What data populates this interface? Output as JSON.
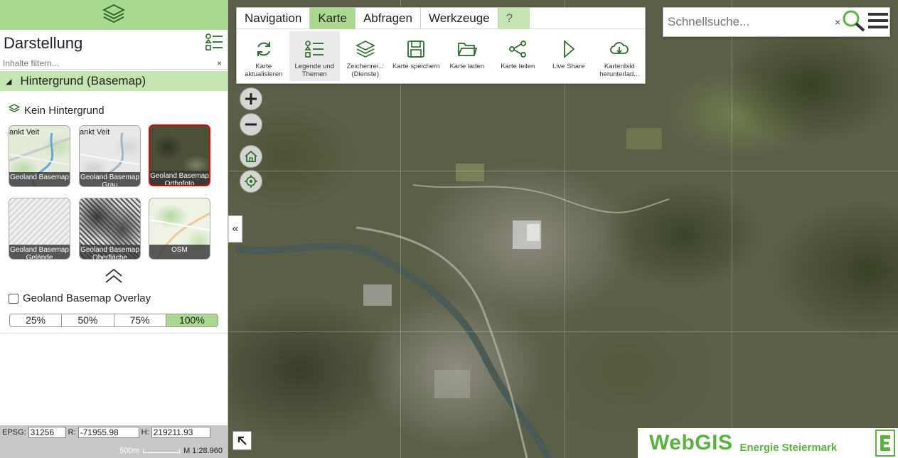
{
  "sidebar": {
    "title": "Darstellung",
    "filter_placeholder": "Inhalte filtern...",
    "filter_clear": "×",
    "section_title": "Hintergrund (Basemap)",
    "no_background_label": "Kein Hintergrund",
    "basemaps": [
      {
        "caption": "Geoland Basemap",
        "top_label": "ankt Veit",
        "selected": false
      },
      {
        "caption": "Geoland Basemap Grau",
        "top_label": "ankt Veit",
        "selected": false
      },
      {
        "caption": "Geoland Basemap Orthofoto",
        "top_label": "",
        "selected": true
      },
      {
        "caption": "Geoland Basemap Gelände",
        "top_label": "",
        "selected": false
      },
      {
        "caption": "Geoland Basemap Oberfläche",
        "top_label": "",
        "selected": false
      },
      {
        "caption": "OSM",
        "top_label": "",
        "selected": false
      }
    ],
    "overlay_label": "Geoland Basemap Overlay",
    "opacity_options": [
      "25%",
      "50%",
      "75%",
      "100%"
    ],
    "opacity_selected": "100%"
  },
  "coords": {
    "epsg_label": "EPSG:",
    "epsg_value": "31256",
    "r_label": "R:",
    "r_value": "-71955.98",
    "h_label": "H:",
    "h_value": "219211.93",
    "scale_bar_label": "500m",
    "scale_label": "M 1:28.960"
  },
  "ribbon": {
    "tabs": [
      {
        "label": "Navigation",
        "active": false
      },
      {
        "label": "Karte",
        "active": true
      },
      {
        "label": "Abfragen",
        "active": false
      },
      {
        "label": "Werkzeuge",
        "active": false
      },
      {
        "label": "?",
        "active": false
      }
    ],
    "tools": [
      {
        "label": "Karte aktualisieren",
        "icon": "refresh-icon"
      },
      {
        "label": "Legende und Themen",
        "icon": "legend-icon"
      },
      {
        "label": "Zeichenrei... (Dienste)",
        "icon": "layers-icon"
      },
      {
        "label": "Karte speichern",
        "icon": "save-icon"
      },
      {
        "label": "Karte laden",
        "icon": "folder-icon"
      },
      {
        "label": "Karte teilen",
        "icon": "share-icon"
      },
      {
        "label": "Live Share",
        "icon": "play-icon"
      },
      {
        "label": "Kartenbild herunterlad...",
        "icon": "cloud-download-icon"
      }
    ]
  },
  "search": {
    "placeholder": "Schnellsuche...",
    "clear": "×"
  },
  "logo": {
    "main": "WebGIS",
    "sub": "Energie Steiermark",
    "mark": "E"
  },
  "colors": {
    "accent_green": "#a9d98f",
    "light_green": "#c4e4b2",
    "logo_green": "#5ab23f",
    "selected_border": "#dd0000"
  }
}
